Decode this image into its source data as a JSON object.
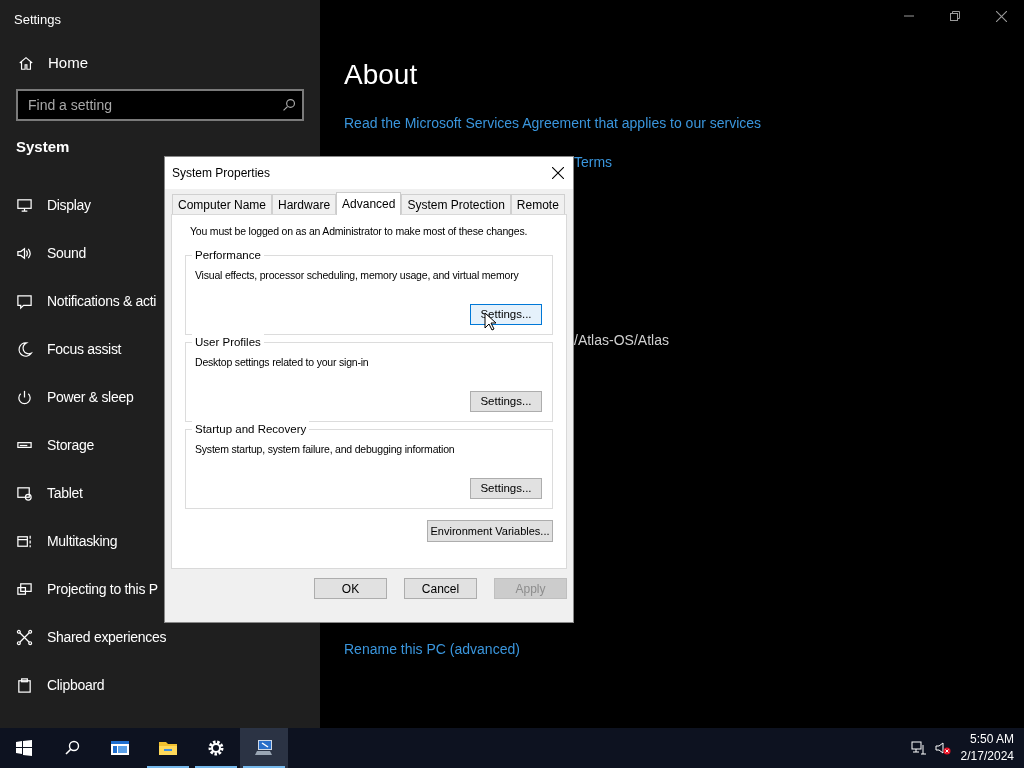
{
  "window": {
    "title": "Settings"
  },
  "sidebar": {
    "home": "Home",
    "search": {
      "placeholder": "Find a setting"
    },
    "section": "System",
    "items": [
      {
        "label": "Display"
      },
      {
        "label": "Sound"
      },
      {
        "label": "Notifications & acti"
      },
      {
        "label": "Focus assist"
      },
      {
        "label": "Power & sleep"
      },
      {
        "label": "Storage"
      },
      {
        "label": "Tablet"
      },
      {
        "label": "Multitasking"
      },
      {
        "label": "Projecting to this P"
      },
      {
        "label": "Shared experiences"
      },
      {
        "label": "Clipboard"
      }
    ]
  },
  "main": {
    "heading": "About",
    "link_1": "Read the Microsoft Services Agreement that applies to our services",
    "link_2_visible": "Terms",
    "text_visible": "/Atlas-OS/Atlas",
    "link_3": "Rename this PC (advanced)"
  },
  "dialog": {
    "title": "System Properties",
    "tabs": [
      {
        "label": "Computer Name",
        "selected": false
      },
      {
        "label": "Hardware",
        "selected": false
      },
      {
        "label": "Advanced",
        "selected": true
      },
      {
        "label": "System Protection",
        "selected": false
      },
      {
        "label": "Remote",
        "selected": false
      }
    ],
    "notice": "You must be logged on as an Administrator to make most of these changes.",
    "groups": [
      {
        "title": "Performance",
        "description": "Visual effects, processor scheduling, memory usage, and virtual memory",
        "button": {
          "label": "Settings...",
          "hovered": true
        }
      },
      {
        "title": "User Profiles",
        "description": "Desktop settings related to your sign-in",
        "button": {
          "label": "Settings...",
          "hovered": false
        }
      },
      {
        "title": "Startup and Recovery",
        "description": "System startup, system failure, and debugging information",
        "button": {
          "label": "Settings...",
          "hovered": false
        }
      }
    ],
    "env_button": "Environment Variables...",
    "buttons": [
      {
        "label": "OK",
        "disabled": false
      },
      {
        "label": "Cancel",
        "disabled": false
      },
      {
        "label": "Apply",
        "disabled": true
      }
    ]
  },
  "taskbar": {
    "apps": [
      {
        "running": false,
        "selected": false
      },
      {
        "running": true,
        "selected": false
      },
      {
        "running": true,
        "selected": false
      },
      {
        "running": true,
        "selected": true
      }
    ],
    "time": "5:50 AM",
    "date": "2/17/2024"
  }
}
